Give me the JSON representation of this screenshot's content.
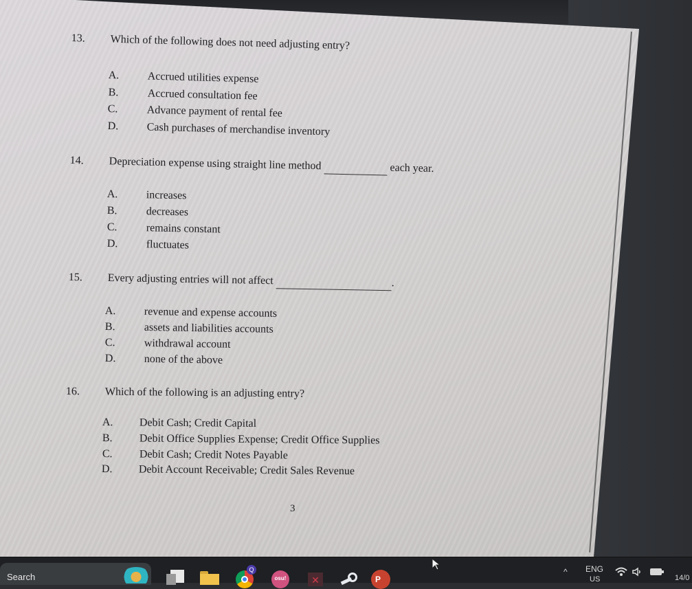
{
  "document": {
    "questions": [
      {
        "number": "13.",
        "text": "Which of the following does not need adjusting entry?",
        "options": [
          {
            "letter": "A.",
            "text": "Accrued utilities expense"
          },
          {
            "letter": "B.",
            "text": "Accrued consultation fee"
          },
          {
            "letter": "C.",
            "text": "Advance payment of rental fee"
          },
          {
            "letter": "D.",
            "text": "Cash purchases of merchandise inventory"
          }
        ]
      },
      {
        "number": "14.",
        "text_before_blank": "Depreciation expense using straight line method",
        "text_after_blank": "each year.",
        "options": [
          {
            "letter": "A.",
            "text": "increases"
          },
          {
            "letter": "B.",
            "text": "decreases"
          },
          {
            "letter": "C.",
            "text": "remains constant"
          },
          {
            "letter": "D.",
            "text": "fluctuates"
          }
        ]
      },
      {
        "number": "15.",
        "text_before_blank": "Every adjusting entries will not affect",
        "text_after_blank": ".",
        "options": [
          {
            "letter": "A.",
            "text": "revenue and expense accounts"
          },
          {
            "letter": "B.",
            "text": "assets and liabilities accounts"
          },
          {
            "letter": "C.",
            "text": "withdrawal account"
          },
          {
            "letter": "D.",
            "text": "none of the above"
          }
        ]
      },
      {
        "number": "16.",
        "text": "Which of the following is an adjusting entry?",
        "options": [
          {
            "letter": "A.",
            "text": "Debit Cash; Credit Capital"
          },
          {
            "letter": "B.",
            "text": "Debit Office Supplies Expense; Credit Office Supplies"
          },
          {
            "letter": "C.",
            "text": "Debit Cash; Credit Notes Payable"
          },
          {
            "letter": "D.",
            "text": "Debit Account Receivable; Credit Sales Revenue"
          }
        ]
      }
    ],
    "page_number": "3"
  },
  "taskbar": {
    "search_label": "Search",
    "apps": [
      {
        "name": "widgets-icon"
      },
      {
        "name": "task-view-icon"
      },
      {
        "name": "file-explorer-icon"
      },
      {
        "name": "chrome-icon",
        "badge": "Q"
      },
      {
        "name": "osu-icon",
        "label": "osu!"
      },
      {
        "name": "app-icon"
      },
      {
        "name": "steam-icon"
      },
      {
        "name": "powerpoint-icon",
        "label": "P"
      }
    ],
    "tray": {
      "language": "ENG",
      "layout": "US",
      "time": "14/0"
    }
  },
  "colors": {
    "paper": "#d6d3d4",
    "text": "#1f1f22",
    "taskbar": "#1e2023",
    "powerpoint": "#c8432f",
    "osu": "#d0527f"
  }
}
